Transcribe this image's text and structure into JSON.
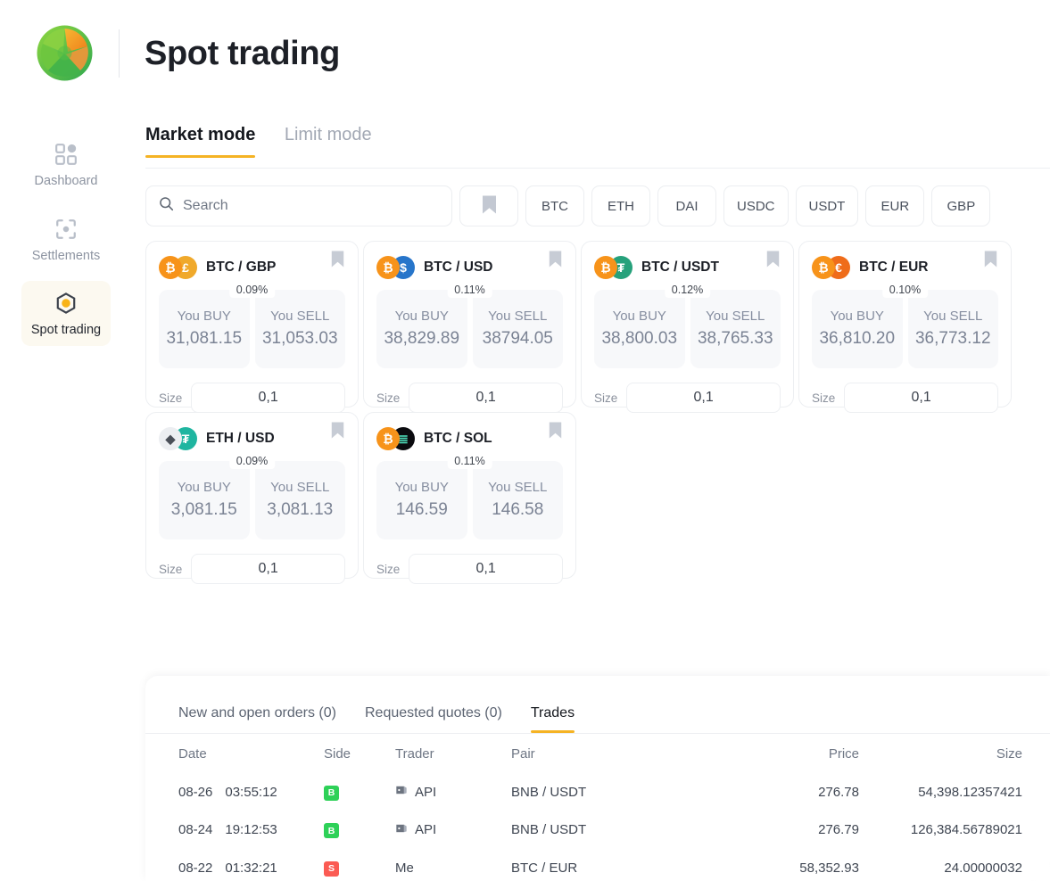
{
  "header": {
    "title": "Spot trading",
    "logo_icon": "aperture-logo-icon"
  },
  "sidebar": {
    "items": [
      {
        "label": "Dashboard",
        "icon": "dashboard-grid-icon",
        "active": false
      },
      {
        "label": "Settlements",
        "icon": "settlements-target-icon",
        "active": false
      },
      {
        "label": "Spot trading",
        "icon": "hexagon-spot-icon",
        "active": true
      }
    ]
  },
  "mode_tabs": [
    {
      "label": "Market mode",
      "active": true
    },
    {
      "label": "Limit mode",
      "active": false
    }
  ],
  "filter_bar": {
    "search": {
      "placeholder": "Search",
      "value": "",
      "icon": "search-icon"
    },
    "bookmark_icon": "bookmark-icon",
    "chips": [
      "BTC",
      "ETH",
      "DAI",
      "USDC",
      "USDT",
      "EUR",
      "GBP"
    ]
  },
  "cards": [
    {
      "pair": "BTC / GBP",
      "pct": "0.09%",
      "buy_label": "You BUY",
      "buy_value": "31,081.15",
      "sell_label": "You SELL",
      "sell_value": "31,053.03",
      "size_label": "Size",
      "size_value": "0,1",
      "coin1": {
        "symbol": "₿",
        "bg": "#f7931a",
        "name": "btc-icon"
      },
      "coin2": {
        "symbol": "£",
        "bg": "#f0a92b",
        "name": "gbp-icon"
      },
      "bookmark_icon": "bookmark-icon"
    },
    {
      "pair": "BTC / USD",
      "pct": "0.11%",
      "buy_label": "You BUY",
      "buy_value": "38,829.89",
      "sell_label": "You SELL",
      "sell_value": "38794.05",
      "size_label": "Size",
      "size_value": "0,1",
      "coin1": {
        "symbol": "₿",
        "bg": "#f7931a",
        "name": "btc-icon"
      },
      "coin2": {
        "symbol": "$",
        "bg": "#2775ca",
        "name": "usd-icon"
      },
      "bookmark_icon": "bookmark-icon"
    },
    {
      "pair": "BTC / USDT",
      "pct": "0.12%",
      "buy_label": "You BUY",
      "buy_value": "38,800.03",
      "sell_label": "You SELL",
      "sell_value": "38,765.33",
      "size_label": "Size",
      "size_value": "0,1",
      "coin1": {
        "symbol": "₿",
        "bg": "#f7931a",
        "name": "btc-icon"
      },
      "coin2": {
        "symbol": "₮",
        "bg": "#26a17b",
        "name": "usdt-icon"
      },
      "bookmark_icon": "bookmark-icon"
    },
    {
      "pair": "BTC / EUR",
      "pct": "0.10%",
      "buy_label": "You BUY",
      "buy_value": "36,810.20",
      "sell_label": "You SELL",
      "sell_value": "36,773.12",
      "size_label": "Size",
      "size_value": "0,1",
      "coin1": {
        "symbol": "₿",
        "bg": "#f7931a",
        "name": "btc-icon"
      },
      "coin2": {
        "symbol": "€",
        "bg": "#ef6c1a",
        "name": "eur-icon"
      },
      "bookmark_icon": "bookmark-icon"
    },
    {
      "pair": "ETH / USD",
      "pct": "0.09%",
      "buy_label": "You BUY",
      "buy_value": "3,081.15",
      "sell_label": "You SELL",
      "sell_value": "3,081.13",
      "size_label": "Size",
      "size_value": "0,1",
      "coin1": {
        "symbol": "◆",
        "bg": "#eceef1",
        "fg": "#4a4f58",
        "name": "eth-icon"
      },
      "coin2": {
        "symbol": "₮",
        "bg": "#1fb5a0",
        "name": "usd-teal-icon"
      },
      "bookmark_icon": "bookmark-icon"
    },
    {
      "pair": "BTC / SOL",
      "pct": "0.11%",
      "buy_label": "You BUY",
      "buy_value": "146.59",
      "sell_label": "You SELL",
      "sell_value": "146.58",
      "size_label": "Size",
      "size_value": "0,1",
      "coin1": {
        "symbol": "₿",
        "bg": "#f7931a",
        "name": "btc-icon"
      },
      "coin2": {
        "symbol": "≣",
        "bg": "#0b0b0f",
        "fg": "#4fe3c0",
        "name": "sol-icon"
      },
      "bookmark_icon": "bookmark-icon"
    }
  ],
  "bottom_panel": {
    "tabs": [
      {
        "label": "New and open orders (0)",
        "active": false
      },
      {
        "label": "Requested quotes (0)",
        "active": false
      },
      {
        "label": "Trades",
        "active": true
      }
    ],
    "columns": [
      "Date",
      "Side",
      "Trader",
      "Pair",
      "Price",
      "Size"
    ],
    "rows": [
      {
        "date": "08-26",
        "time": "03:55:12",
        "side": "B",
        "side_type": "buy",
        "trader": "API",
        "trader_icon": "api-icon",
        "pair": "BNB / USDT",
        "price": "276.78",
        "size": "54,398.12357421"
      },
      {
        "date": "08-24",
        "time": "19:12:53",
        "side": "B",
        "side_type": "buy",
        "trader": "API",
        "trader_icon": "api-icon",
        "pair": "BNB / USDT",
        "price": "276.79",
        "size": "126,384.56789021"
      },
      {
        "date": "08-22",
        "time": "01:32:21",
        "side": "S",
        "side_type": "sell",
        "trader": "Me",
        "trader_icon": "",
        "pair": "BTC / EUR",
        "price": "58,352.93",
        "size": "24.00000032"
      }
    ]
  },
  "colors": {
    "accent": "#f5b324",
    "buy_badge": "#2ed158",
    "sell_badge": "#fb5b53",
    "active_nav_bg": "#fcf9f0",
    "panel_bg": "#f7f8fa"
  }
}
